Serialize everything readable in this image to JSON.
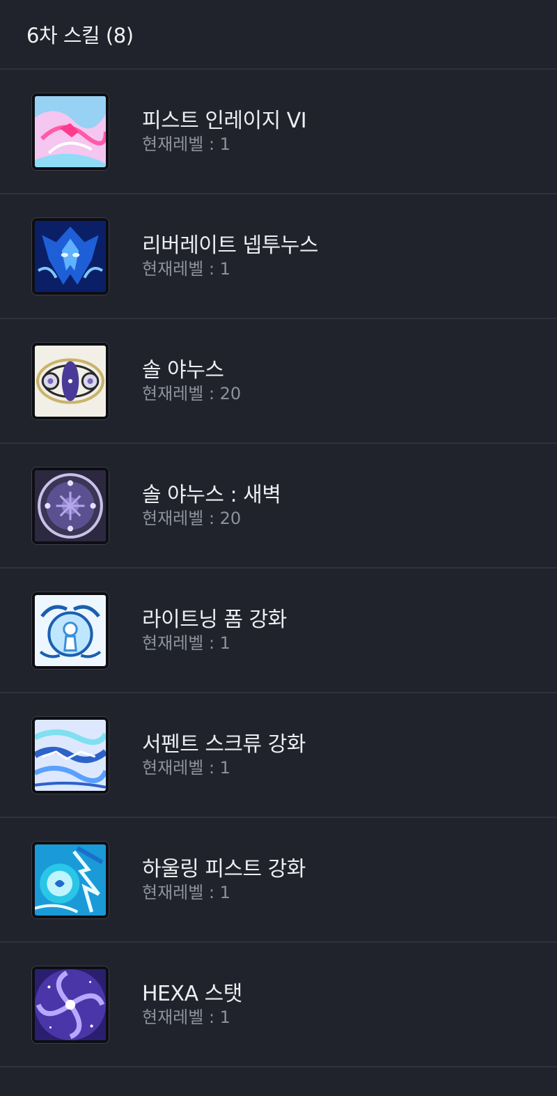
{
  "header": {
    "title": "6차 스킬 (8)"
  },
  "skills": [
    {
      "name": "피스트 인레이지 VI",
      "level": "현재레벨 : 1",
      "icon": "fist-enrage-icon",
      "colors": [
        "#f2a0e8",
        "#7fd3f5",
        "#ff5aa8"
      ]
    },
    {
      "name": "리버레이트 넵투누스",
      "level": "현재레벨 : 1",
      "icon": "liberate-neptunus-icon",
      "colors": [
        "#1448c8",
        "#5fb2ff",
        "#0a1f66"
      ]
    },
    {
      "name": "솔 야누스",
      "level": "현재레벨 : 20",
      "icon": "sol-janus-icon",
      "colors": [
        "#f3f2ec",
        "#5a4aa8",
        "#c9b26a"
      ]
    },
    {
      "name": "솔 야누스 : 새벽",
      "level": "현재레벨 : 20",
      "icon": "sol-janus-dawn-icon",
      "colors": [
        "#3b3556",
        "#8a7cc8",
        "#d6d0f0"
      ]
    },
    {
      "name": "라이트닝 폼 강화",
      "level": "현재레벨 : 1",
      "icon": "lightning-form-icon",
      "colors": [
        "#eaf6ff",
        "#1a5fb0",
        "#8ed6ff"
      ]
    },
    {
      "name": "서펜트 스크류 강화",
      "level": "현재레벨 : 1",
      "icon": "serpent-screw-icon",
      "colors": [
        "#d8e6ff",
        "#2d63c9",
        "#7fe0f0"
      ]
    },
    {
      "name": "하울링 피스트 강화",
      "level": "현재레벨 : 1",
      "icon": "howling-fist-icon",
      "colors": [
        "#29c6e8",
        "#eafcff",
        "#1b6ec9"
      ]
    },
    {
      "name": "HEXA 스탯",
      "level": "현재레벨 : 1",
      "icon": "hexa-stat-icon",
      "colors": [
        "#6b4fc9",
        "#2a1f6e",
        "#b9a8ff"
      ]
    }
  ]
}
